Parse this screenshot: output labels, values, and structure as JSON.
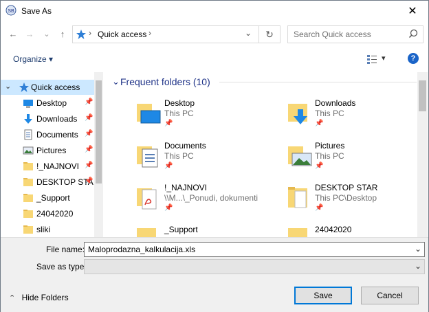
{
  "window": {
    "title": "Save As",
    "close_glyph": "✕"
  },
  "nav": {
    "back_glyph": "←",
    "forward_glyph": "→",
    "recent_glyph": "⌄",
    "up_glyph": "↑",
    "address_location": "Quick access",
    "address_sep": "›",
    "address_dropdown_glyph": "⌄",
    "refresh_glyph": "↻",
    "search_placeholder": "Search Quick access"
  },
  "toolbar": {
    "organize_label": "Organize ▾",
    "view_glyph": "▾",
    "help_glyph": "?"
  },
  "navpane": {
    "expand_glyph": "⌄",
    "items": [
      {
        "label": "Quick access",
        "icon": "star-icon"
      },
      {
        "label": "Desktop",
        "icon": "desktop-icon",
        "pin": "📌"
      },
      {
        "label": "Downloads",
        "icon": "downloads-icon",
        "pin": "📌"
      },
      {
        "label": "Documents",
        "icon": "documents-icon",
        "pin": "📌"
      },
      {
        "label": "Pictures",
        "icon": "pictures-icon",
        "pin": "📌"
      },
      {
        "label": "!_NAJNOVI",
        "icon": "folder-icon",
        "pin": "📌"
      },
      {
        "label": "DESKTOP STA",
        "icon": "folder-icon",
        "pin": "📌"
      },
      {
        "label": "_Support",
        "icon": "folder-icon"
      },
      {
        "label": "24042020",
        "icon": "folder-icon"
      },
      {
        "label": "sliki",
        "icon": "folder-icon"
      }
    ]
  },
  "content": {
    "group_title": "Frequent folders (10)",
    "pin_glyph": "📌",
    "tiles": [
      {
        "name": "Desktop",
        "sub": "This PC",
        "icon": "desktop-folder-icon"
      },
      {
        "name": "Downloads",
        "sub": "This PC",
        "icon": "downloads-folder-icon"
      },
      {
        "name": "Documents",
        "sub": "This PC",
        "icon": "documents-folder-icon"
      },
      {
        "name": "Pictures",
        "sub": "This PC",
        "icon": "pictures-folder-icon"
      },
      {
        "name": "!_NAJNOVI",
        "sub": "\\\\M...\\_Ponudi, dokumenti",
        "icon": "pdf-folder-icon"
      },
      {
        "name": "DESKTOP STAR",
        "sub": "This PC\\Desktop",
        "icon": "folder-icon"
      },
      {
        "name": "_Support",
        "sub": "",
        "icon": "folder-icon"
      },
      {
        "name": "24042020",
        "sub": "",
        "icon": "folder-icon"
      }
    ]
  },
  "bottom": {
    "filename_label": "File name:",
    "filename_value": "Maloprodazna_kalkulacija.xls",
    "savetype_label": "Save as type:",
    "savetype_value": "",
    "dropdown_glyph": "⌄",
    "hide_folders_label": "Hide Folders",
    "hide_folders_glyph": "⌃",
    "save_label": "Save",
    "cancel_label": "Cancel"
  },
  "colors": {
    "accent": "#0078d7",
    "selection": "#cce8ff",
    "group_header": "#1e3287",
    "folder": "#f8d775"
  }
}
